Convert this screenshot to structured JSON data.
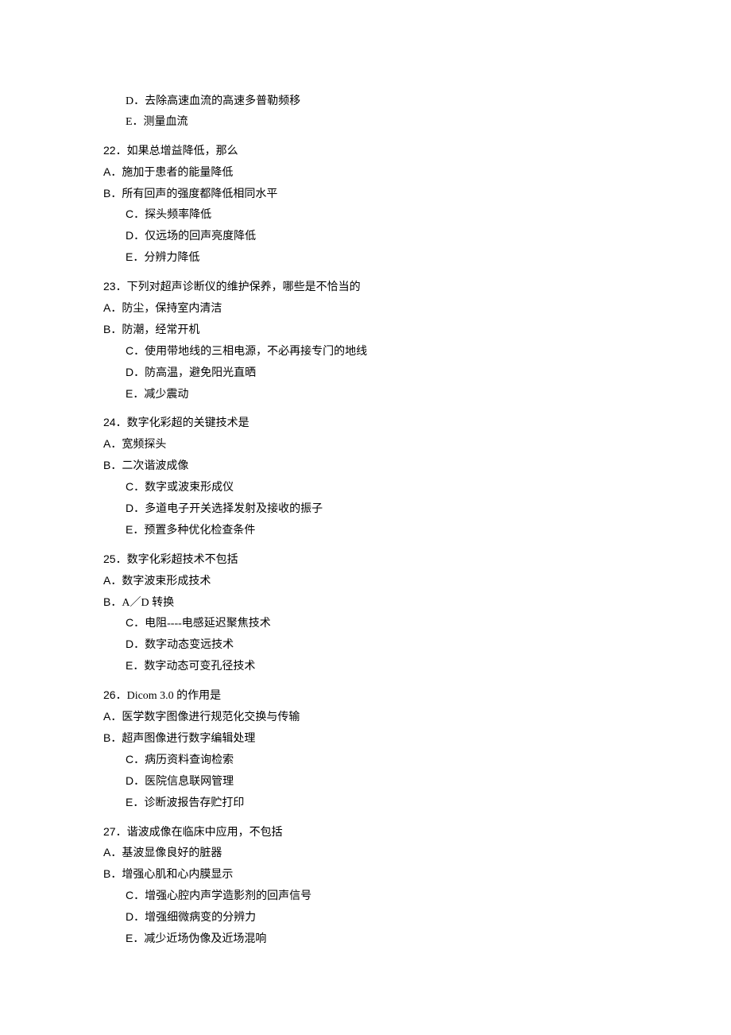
{
  "fragments": {
    "pre": [
      {
        "text": "D．去除高速血流的高速多普勒频移",
        "indent": 1,
        "highlight": false
      },
      {
        "text": "E．测量血流",
        "indent": 1,
        "highlight": false
      }
    ]
  },
  "questions": [
    {
      "num": "22．",
      "stem": "如果总增益降低，那么",
      "options": [
        {
          "label": "A．",
          "text": "施加于患者的能量降低",
          "indent": 0,
          "highlight": false
        },
        {
          "label": "B．",
          "text": "所有回声的强度都降低相同水平",
          "indent": 0,
          "highlight": true,
          "tail": ""
        },
        {
          "label": "C．",
          "text": "探头频率降低",
          "indent": 1,
          "highlight": false
        },
        {
          "label": "D．",
          "text": "仅远场的回声亮度降低",
          "indent": 1,
          "highlight": false
        },
        {
          "label": "E．",
          "text": "分辨力降低",
          "indent": 1,
          "highlight": false
        }
      ]
    },
    {
      "num": "23．",
      "stem": "下列对超声诊断仪的维护保养，哪些是不恰当的",
      "options": [
        {
          "label": "A．",
          "text": "防尘，保持室内清洁",
          "indent": 0,
          "highlight": false
        },
        {
          "label": "B．",
          "text": "防潮，经常开机",
          "indent": 0,
          "highlight": false
        },
        {
          "label": "C．",
          "text": "使用带地线的三相电源，不必再接专门的地",
          "indent": 1,
          "highlight": true,
          "tail": "线"
        },
        {
          "label": "D．",
          "text": "防高温，避免阳光直晒",
          "indent": 1,
          "highlight": false
        },
        {
          "label": "E．",
          "text": "减少震动",
          "indent": 1,
          "highlight": false
        }
      ]
    },
    {
      "num": "24．",
      "stem": "数字化彩超的关键技术是",
      "options": [
        {
          "label": "A．",
          "text": "宽频探头",
          "indent": 0,
          "highlight": false
        },
        {
          "label": "B．",
          "text": "二次谐波成像",
          "indent": 0,
          "highlight": false
        },
        {
          "label": "C．",
          "text": "数字或波束形成仪",
          "indent": 1,
          "highlight": true,
          "tail": ""
        },
        {
          "label": "D．",
          "text": "多道电子开关选择发射及接收的振子",
          "indent": 1,
          "highlight": false
        },
        {
          "label": "E．",
          "text": "预置多种优化检查条件",
          "indent": 1,
          "highlight": false
        }
      ]
    },
    {
      "num": "25．",
      "stem": "数字化彩超技术不包括",
      "options": [
        {
          "label": "A．",
          "text": "数字波束形成技术",
          "indent": 0,
          "highlight": false
        },
        {
          "label": "B．",
          "text": "A／D 转换",
          "indent": 0,
          "highlight": false
        },
        {
          "label": "C．",
          "text": "电阻----电感延迟聚焦技",
          "indent": 1,
          "highlight": true,
          "tail": "术"
        },
        {
          "label": "D．",
          "text": "数字动态变远技术",
          "indent": 1,
          "highlight": false
        },
        {
          "label": "E．",
          "text": "数字动态可变孔径技术",
          "indent": 1,
          "highlight": false
        }
      ]
    },
    {
      "num": "26．",
      "stem": "Dicom 3.0 的作用是",
      "options": [
        {
          "label": "A．",
          "text": "医学数字图像进行规范化交换与传输",
          "indent": 0,
          "highlight": true,
          "tail": ""
        },
        {
          "label": "B．",
          "text": "超声图像进行数字编辑处理",
          "indent": 0,
          "highlight": false
        },
        {
          "label": "C．",
          "text": "病历资料查询检索",
          "indent": 1,
          "highlight": false
        },
        {
          "label": "D．",
          "text": "医院信息联网管理",
          "indent": 1,
          "highlight": false
        },
        {
          "label": "E．",
          "text": "诊断波报告存贮打印",
          "indent": 1,
          "highlight": false
        }
      ]
    },
    {
      "num": "27．",
      "stem": "谐波成像在临床中应用，不包括",
      "options": [
        {
          "label": "A．",
          "text": "基波显像良好的脏器",
          "indent": 0,
          "highlight": true,
          "tail": ""
        },
        {
          "label": "B．",
          "text": "增强心肌和心内膜显示",
          "indent": 0,
          "highlight": false
        },
        {
          "label": "C．",
          "text": "增强心腔内声学造影剂的回声信号",
          "indent": 1,
          "highlight": false
        },
        {
          "label": "D．",
          "text": "增强细微病变的分辨力",
          "indent": 1,
          "highlight": false
        },
        {
          "label": "E．",
          "text": "减少近场伪像及近场混响",
          "indent": 1,
          "highlight": false
        }
      ]
    }
  ]
}
